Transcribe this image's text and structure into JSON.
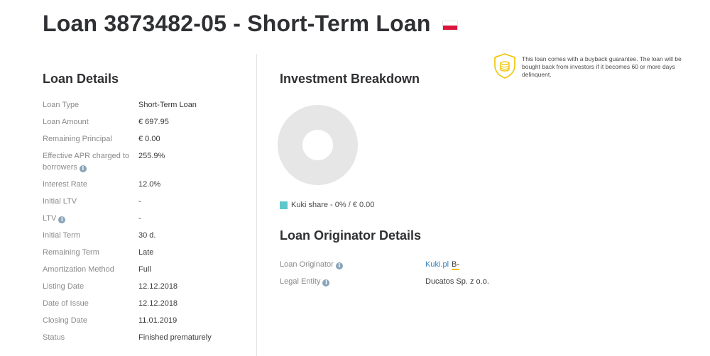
{
  "page": {
    "title": "Loan 3873482-05 - Short-Term Loan",
    "flag_country": "Poland"
  },
  "loan_details": {
    "title": "Loan Details",
    "rows": [
      {
        "label": "Loan Type",
        "value": "Short-Term Loan"
      },
      {
        "label": "Loan Amount",
        "value": "€ 697.95"
      },
      {
        "label": "Remaining Principal",
        "value": "€ 0.00"
      },
      {
        "label": "Effective APR charged to borrowers",
        "value": "255.9%"
      },
      {
        "label": "Interest Rate",
        "value": "12.0%"
      },
      {
        "label": "Initial LTV",
        "value": "-"
      },
      {
        "label": "LTV",
        "value": "-"
      },
      {
        "label": "Initial Term",
        "value": "30 d."
      },
      {
        "label": "Remaining Term",
        "value": "Late"
      },
      {
        "label": "Amortization Method",
        "value": "Full"
      },
      {
        "label": "Listing Date",
        "value": "12.12.2018"
      },
      {
        "label": "Date of Issue",
        "value": "12.12.2018"
      },
      {
        "label": "Closing Date",
        "value": "11.01.2019"
      },
      {
        "label": "Status",
        "value": "Finished prematurely"
      }
    ]
  },
  "investment": {
    "title": "Investment Breakdown",
    "legend": "Kuki share - 0% / € 0.00",
    "legend_color": "#5ec7cc",
    "donut_color": "#e6e6e6",
    "share_percent": 0
  },
  "originator": {
    "title": "Loan Originator Details",
    "originator_label": "Loan Originator",
    "originator_name": "Kuki.pl",
    "originator_rating": "B-",
    "legal_entity_label": "Legal Entity",
    "legal_entity_value": "Ducatos Sp. z o.o."
  },
  "guarantee": {
    "text": "This loan comes with a buyback guarantee. The loan will be bought back from investors if it becomes 60 or more days delinquent.",
    "icon": "shield-coins-icon",
    "icon_color": "#f2c200"
  }
}
